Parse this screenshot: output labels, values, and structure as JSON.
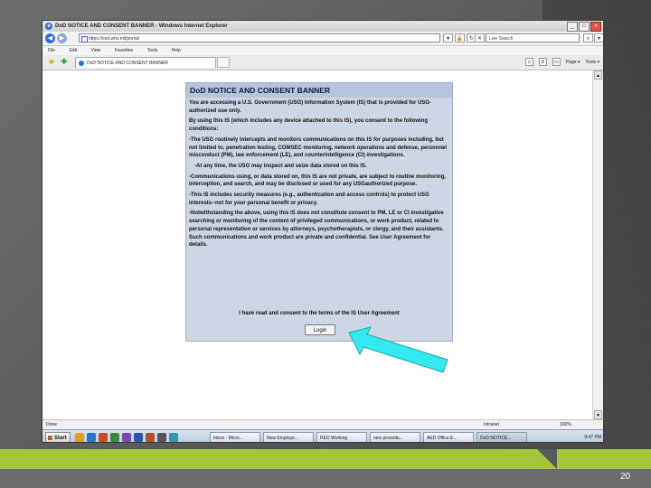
{
  "slide": {
    "page_number": "20",
    "colors": {
      "band_lime": "#a4c63c",
      "background": "#5c5c5c",
      "pointer_arrow": "#34e8f0"
    }
  },
  "browser": {
    "title": "DoD NOTICE AND CONSENT BANNER - Windows Internet Explorer",
    "url": "https://esd.whs.mil/portal/",
    "search_placeholder": "Live Search",
    "menu": [
      "File",
      "Edit",
      "View",
      "Favorites",
      "Tools",
      "Help"
    ],
    "tab_label": "DoD NOTICE AND CONSENT BANNER",
    "command_bar": {
      "page_label": "Page ▾",
      "tools_label": "Tools ▾"
    },
    "status": {
      "text": "Done",
      "zone": "Intranet",
      "zoom": "100%"
    }
  },
  "banner": {
    "header": "DoD NOTICE AND CONSENT BANNER",
    "paragraphs": [
      "You are accessing a U.S. Government (USG) Information System (IS) that is provided for USG-authorized use only.",
      "By using this IS (which includes any device attached to this IS), you consent to the following conditions:",
      "-The USG routinely intercepts and monitors communications on this IS for purposes including, but not limited to, penetration testing, COMSEC monitoring, network operations and defense, personnel misconduct (PM), law enforcement (LE), and counterintelligence (CI) investigations.",
      "-At any time, the USG may inspect and seize data stored on this IS.",
      "-Communications using, or data stored on, this IS are not private, are subject to routine monitoring, interception, and search, and may be disclosed or used for any USGauthorized purpose.",
      "-This IS includes security measures (e.g., authentication and access controls) to protect USG interests--not for your personal benefit or privacy.",
      "-Notwithstanding the above, using this IS does not constitute consent to PM, LE or CI investigative searching or monitoring of the content of privileged communications, or work product, related to personal representation or services by attorneys, psychotherapists, or clergy, and their assistants. Such communications and work product are private and confidential. See User Agreement for details."
    ],
    "footer": "I have read and consent to the terms of the IS User Agreement",
    "login_label": "Login"
  },
  "taskbar": {
    "start_label": "Start",
    "items": [
      "Inbox - Micro...",
      "New Employe...",
      "RED Working",
      "new procedu...",
      "AED Office E...",
      "DoD NOTICE..."
    ],
    "clock": "9:47 PM"
  }
}
